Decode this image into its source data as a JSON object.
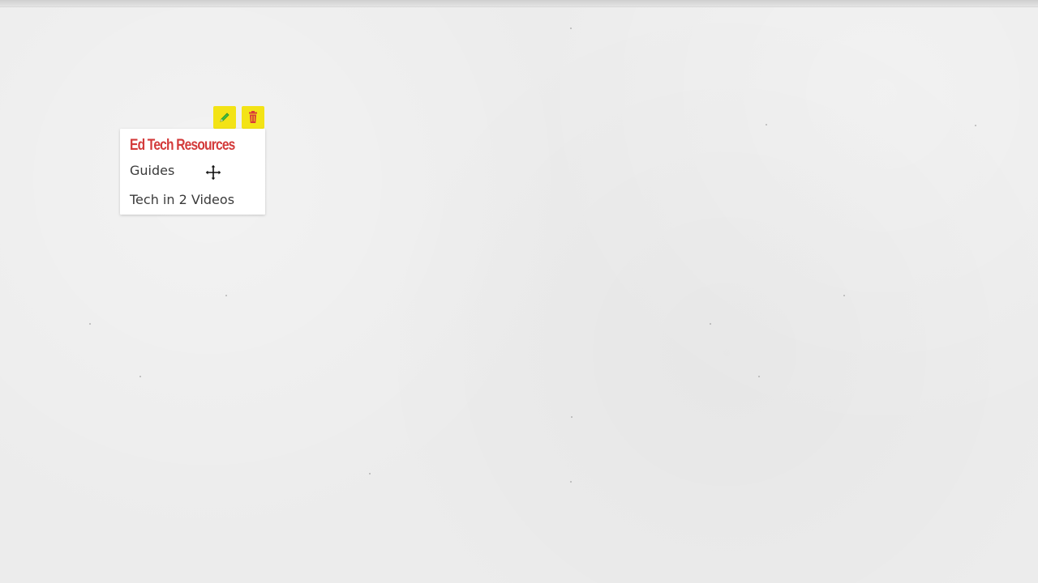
{
  "note": {
    "title": "Ed Tech Resources",
    "lines": [
      "Guides",
      "Tech in 2 Videos"
    ],
    "title_color": "#d33a3a"
  },
  "toolbar": {
    "edit_icon": "pencil-icon",
    "delete_icon": "trash-icon",
    "button_color": "#f3e316"
  },
  "cursor": {
    "icon": "move-cursor-icon"
  }
}
